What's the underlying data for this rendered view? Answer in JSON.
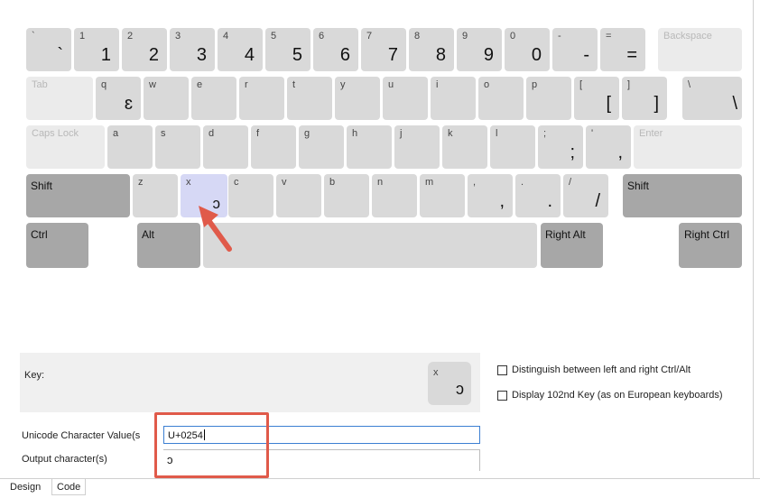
{
  "keyboard": {
    "row1": [
      {
        "id": "backtick",
        "shift": "`",
        "char": "`"
      },
      {
        "id": "1",
        "shift": "1",
        "char": "1"
      },
      {
        "id": "2",
        "shift": "2",
        "char": "2"
      },
      {
        "id": "3",
        "shift": "3",
        "char": "3"
      },
      {
        "id": "4",
        "shift": "4",
        "char": "4"
      },
      {
        "id": "5",
        "shift": "5",
        "char": "5"
      },
      {
        "id": "6",
        "shift": "6",
        "char": "6"
      },
      {
        "id": "7",
        "shift": "7",
        "char": "7"
      },
      {
        "id": "8",
        "shift": "8",
        "char": "8"
      },
      {
        "id": "9",
        "shift": "9",
        "char": "9"
      },
      {
        "id": "0",
        "shift": "0",
        "char": "0"
      },
      {
        "id": "minus",
        "shift": "-",
        "char": "-"
      },
      {
        "id": "equals",
        "shift": "=",
        "char": "="
      },
      {
        "id": "backspace",
        "shift": "Backspace",
        "char": ""
      }
    ],
    "row2": [
      {
        "id": "tab",
        "shift": "Tab",
        "char": ""
      },
      {
        "id": "q",
        "shift": "q",
        "char": "ɛ"
      },
      {
        "id": "w",
        "shift": "w",
        "char": ""
      },
      {
        "id": "e",
        "shift": "e",
        "char": ""
      },
      {
        "id": "r",
        "shift": "r",
        "char": ""
      },
      {
        "id": "t",
        "shift": "t",
        "char": ""
      },
      {
        "id": "y",
        "shift": "y",
        "char": ""
      },
      {
        "id": "u",
        "shift": "u",
        "char": ""
      },
      {
        "id": "i",
        "shift": "i",
        "char": ""
      },
      {
        "id": "o",
        "shift": "o",
        "char": ""
      },
      {
        "id": "p",
        "shift": "p",
        "char": ""
      },
      {
        "id": "lbracket",
        "shift": "[",
        "char": "["
      },
      {
        "id": "rbracket",
        "shift": "]",
        "char": "]"
      },
      {
        "id": "backslash",
        "shift": "\\",
        "char": "\\"
      }
    ],
    "row3": [
      {
        "id": "capslock",
        "shift": "Caps Lock",
        "char": ""
      },
      {
        "id": "a",
        "shift": "a",
        "char": ""
      },
      {
        "id": "s",
        "shift": "s",
        "char": ""
      },
      {
        "id": "d",
        "shift": "d",
        "char": ""
      },
      {
        "id": "f",
        "shift": "f",
        "char": ""
      },
      {
        "id": "g",
        "shift": "g",
        "char": ""
      },
      {
        "id": "h",
        "shift": "h",
        "char": ""
      },
      {
        "id": "j",
        "shift": "j",
        "char": ""
      },
      {
        "id": "k",
        "shift": "k",
        "char": ""
      },
      {
        "id": "l",
        "shift": "l",
        "char": ""
      },
      {
        "id": "semicolon",
        "shift": ";",
        "char": ";"
      },
      {
        "id": "quote",
        "shift": "'",
        "char": ","
      },
      {
        "id": "enter",
        "shift": "Enter",
        "char": ""
      }
    ],
    "row4": [
      {
        "id": "lshift",
        "shift": "Shift",
        "char": ""
      },
      {
        "id": "z",
        "shift": "z",
        "char": ""
      },
      {
        "id": "x",
        "shift": "x",
        "char": "ɔ"
      },
      {
        "id": "c",
        "shift": "c",
        "char": ""
      },
      {
        "id": "v",
        "shift": "v",
        "char": ""
      },
      {
        "id": "b",
        "shift": "b",
        "char": ""
      },
      {
        "id": "n",
        "shift": "n",
        "char": ""
      },
      {
        "id": "m",
        "shift": "m",
        "char": ""
      },
      {
        "id": "comma",
        "shift": ",",
        "char": ","
      },
      {
        "id": "period",
        "shift": ".",
        "char": "."
      },
      {
        "id": "slash",
        "shift": "/",
        "char": "/"
      },
      {
        "id": "rshift",
        "shift": "Shift",
        "char": ""
      }
    ],
    "row5": [
      {
        "id": "ctrl",
        "shift": "Ctrl",
        "char": ""
      },
      {
        "id": "alt",
        "shift": "Alt",
        "char": ""
      },
      {
        "id": "space",
        "shift": "",
        "char": ""
      },
      {
        "id": "ralt",
        "shift": "Right Alt",
        "char": ""
      },
      {
        "id": "rctrl",
        "shift": "Right Ctrl",
        "char": ""
      }
    ]
  },
  "key_panel": {
    "label": "Key:",
    "preview_shift": "x",
    "preview_char": "ɔ"
  },
  "options": {
    "distinguish_ctrl_alt": "Distinguish between left and right Ctrl/Alt",
    "display_102nd": "Display 102nd Key (as on European keyboards)"
  },
  "fields": {
    "unicode_label": "Unicode Character Value(s",
    "unicode_value": "U+0254",
    "output_label": "Output character(s)",
    "output_value": "ɔ"
  },
  "tabs": {
    "design": "Design",
    "code": "Code"
  },
  "colors": {
    "selected_key": "#d6d8f5",
    "highlight_annotation": "#e05a4a",
    "input_focus_border": "#3c7fd2"
  }
}
